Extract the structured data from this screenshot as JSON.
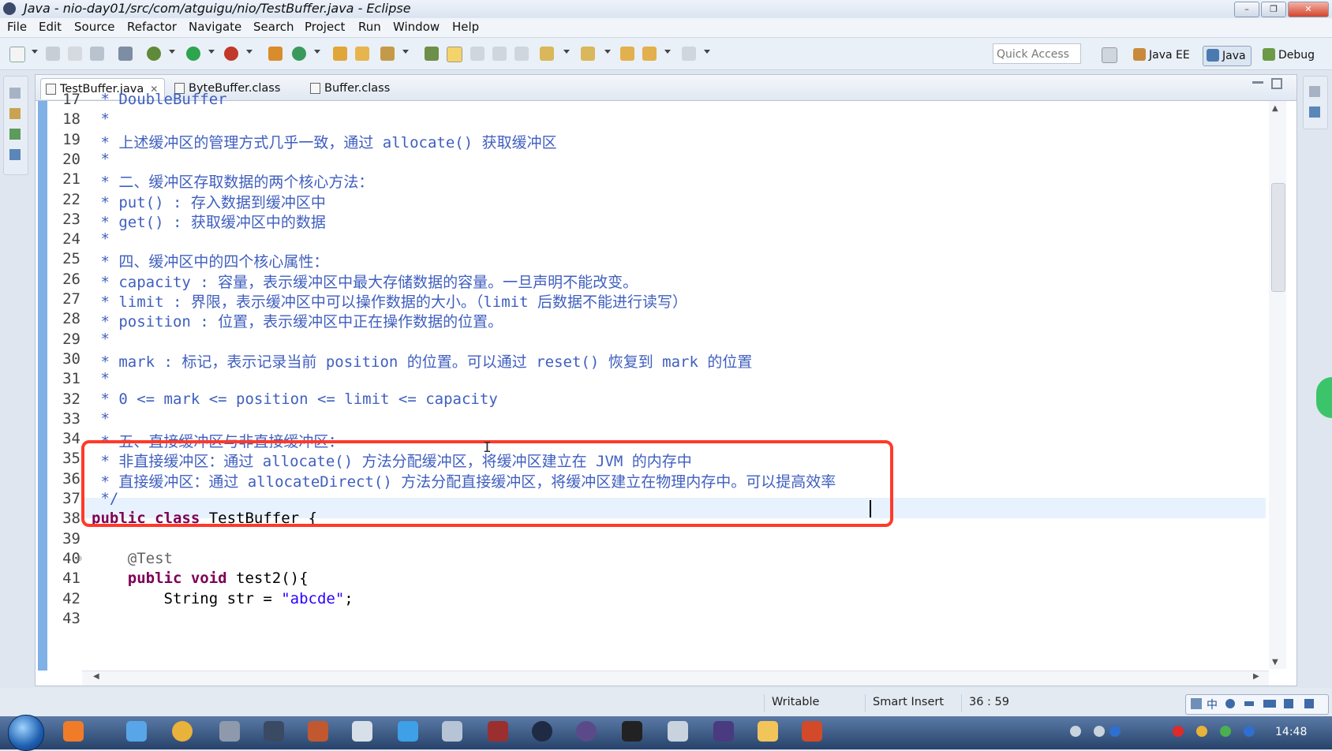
{
  "window": {
    "title": "Java - nio-day01/src/com/atguigu/nio/TestBuffer.java - Eclipse"
  },
  "menu": [
    "File",
    "Edit",
    "Source",
    "Refactor",
    "Navigate",
    "Search",
    "Project",
    "Run",
    "Window",
    "Help"
  ],
  "toolbar": {
    "quick_access": "Quick Access",
    "perspectives": [
      "Java EE",
      "Java",
      "Debug"
    ]
  },
  "tabs": [
    {
      "label": "TestBuffer.java",
      "active": true
    },
    {
      "label": "ByteBuffer.class",
      "active": false
    },
    {
      "label": "Buffer.class",
      "active": false
    }
  ],
  "editor": {
    "lines": [
      {
        "n": "17",
        "text": " * DoubleBuffer"
      },
      {
        "n": "18",
        "text": " *"
      },
      {
        "n": "19",
        "text": " * 上述缓冲区的管理方式几乎一致，通过 allocate() 获取缓冲区"
      },
      {
        "n": "20",
        "text": " *"
      },
      {
        "n": "21",
        "text": " * 二、缓冲区存取数据的两个核心方法："
      },
      {
        "n": "22",
        "text": " * put() : 存入数据到缓冲区中"
      },
      {
        "n": "23",
        "text": " * get() : 获取缓冲区中的数据"
      },
      {
        "n": "24",
        "text": " *"
      },
      {
        "n": "25",
        "text": " * 四、缓冲区中的四个核心属性："
      },
      {
        "n": "26",
        "text": " * capacity : 容量，表示缓冲区中最大存储数据的容量。一旦声明不能改变。"
      },
      {
        "n": "27",
        "text": " * limit : 界限，表示缓冲区中可以操作数据的大小。（limit 后数据不能进行读写）"
      },
      {
        "n": "28",
        "text": " * position : 位置，表示缓冲区中正在操作数据的位置。"
      },
      {
        "n": "29",
        "text": " *"
      },
      {
        "n": "30",
        "text": " * mark : 标记，表示记录当前 position 的位置。可以通过 reset() 恢复到 mark 的位置"
      },
      {
        "n": "31",
        "text": " *"
      },
      {
        "n": "32",
        "text": " * 0 <= mark <= position <= limit <= capacity"
      },
      {
        "n": "33",
        "text": " *"
      },
      {
        "n": "34",
        "text": " * 五、直接缓冲区与非直接缓冲区："
      },
      {
        "n": "35",
        "text": " * 非直接缓冲区：通过 allocate() 方法分配缓冲区，将缓冲区建立在 JVM 的内存中"
      },
      {
        "n": "36",
        "text": " * 直接缓冲区：通过 allocateDirect() 方法分配直接缓冲区，将缓冲区建立在物理内存中。可以提高效率"
      },
      {
        "n": "37",
        "text": " */"
      },
      {
        "n": "38",
        "kw1": "public",
        "kw2": "class",
        "rest": " TestBuffer {"
      },
      {
        "n": "39",
        "text": ""
      },
      {
        "n": "40",
        "ann": "    @Test"
      },
      {
        "n": "41",
        "kw1": "    public",
        "kw2": "void",
        "rest": " test2(){"
      },
      {
        "n": "42",
        "pre": "        String str = ",
        "str": "\"abcde\"",
        "post": ";"
      },
      {
        "n": "43",
        "text": ""
      }
    ]
  },
  "status": {
    "writable": "Writable",
    "insert_mode": "Smart Insert",
    "position": "36 : 59"
  },
  "ime": {
    "lang": "中"
  },
  "clock": "14:48",
  "colors": {
    "highlight_box": "#ff3a2a",
    "ruler": "#7fb0e6",
    "comment": "#3f5fbf",
    "keyword": "#7f0055"
  }
}
